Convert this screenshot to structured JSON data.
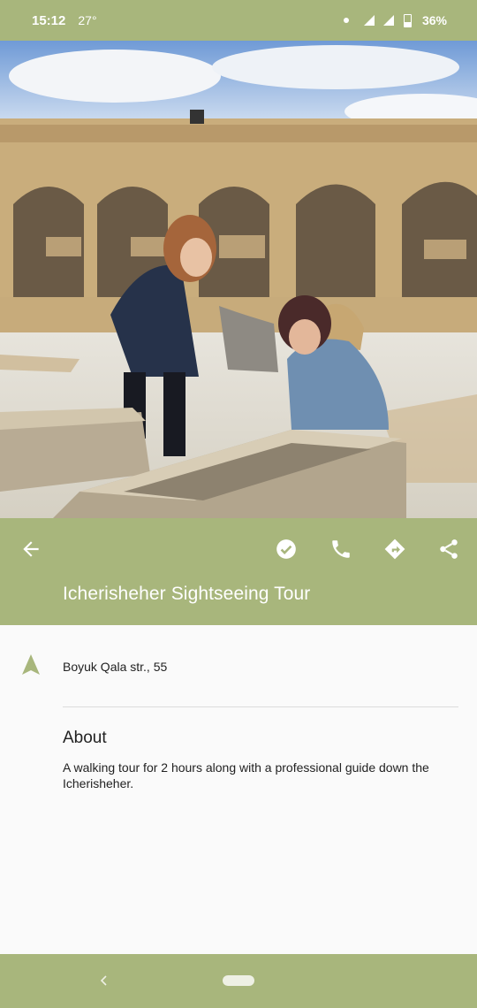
{
  "status_bar": {
    "time": "15:12",
    "temperature": "27°",
    "battery": "36%"
  },
  "place": {
    "title": "Icherisheher Sightseeing Tour",
    "address": "Boyuk Qala str., 55",
    "about_heading": "About",
    "about_text": "A walking tour for 2 hours along with a professional guide down the Icherisheher."
  },
  "icons": {
    "back": "arrow-left-icon",
    "visited": "check-circle-icon",
    "call": "phone-icon",
    "directions": "directions-icon",
    "share": "share-icon",
    "location": "navigation-arrow-icon"
  },
  "colors": {
    "accent": "#a8b67c",
    "background": "#fafafa"
  }
}
